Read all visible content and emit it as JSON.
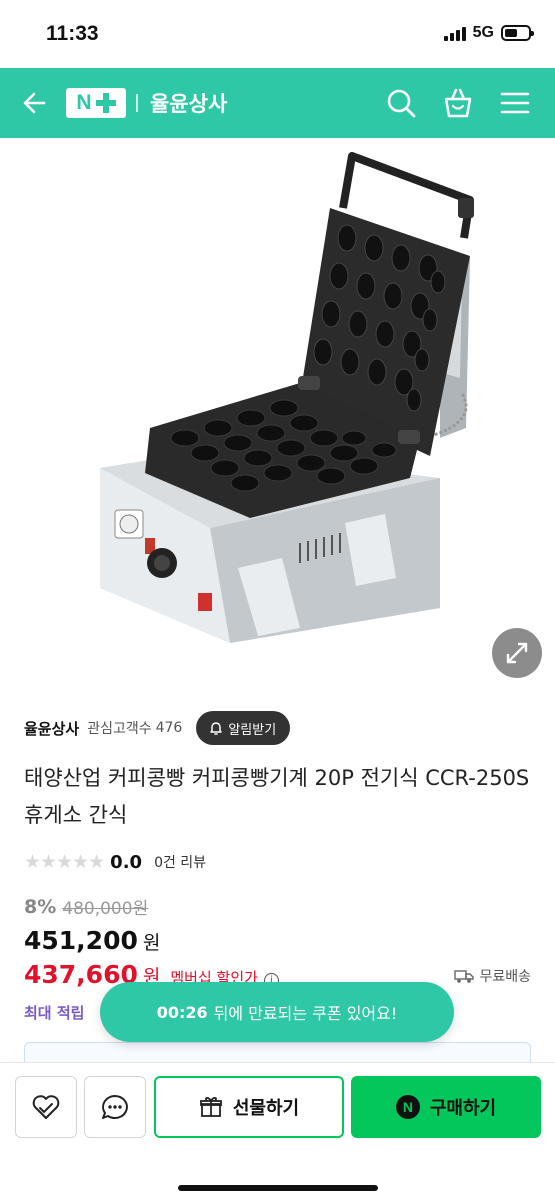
{
  "status_bar": {
    "time": "11:33",
    "network": "5G"
  },
  "header": {
    "store_name": "율윤상사"
  },
  "seller": {
    "name": "율윤상사",
    "follower_label": "관심고객수",
    "follower_count": "476",
    "notify_label": "알림받기"
  },
  "product": {
    "title": "태양산업 커피콩빵 커피콩빵기계 20P 전기식 CCR-250S 휴게소 간식",
    "stars": "★★★★★",
    "rating": "0.0",
    "review_count": "0건 리뷰",
    "discount_rate": "8%",
    "original_price": "480,000원",
    "price": "451,200",
    "price_unit": "원",
    "member_price": "437,660",
    "member_unit": "원",
    "member_label": "멤버십 할인가",
    "shipping": "무료배송",
    "points_label": "최대 적립"
  },
  "toast": {
    "countdown": "00:26",
    "message": "뒤에 만료되는 쿠폰 있어요!"
  },
  "bottom_bar": {
    "gift_label": "선물하기",
    "buy_label": "구매하기",
    "buy_logo": "N"
  },
  "colors": {
    "brand_green": "#2fc8a6",
    "naver_green": "#03c75a",
    "sale_red": "#e0122c",
    "points_purple": "#7a5cc7"
  }
}
